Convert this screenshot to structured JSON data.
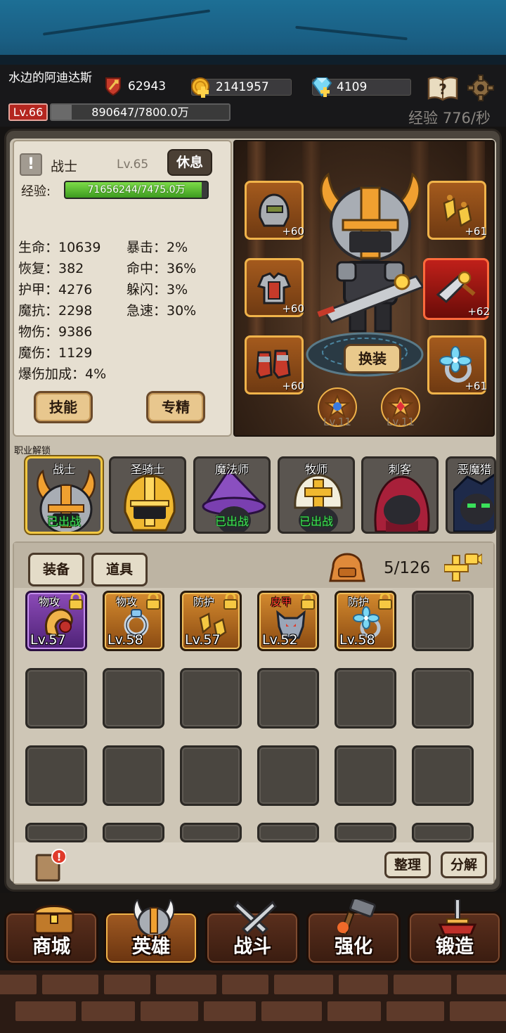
{
  "header": {
    "player_name": "水边的阿迪达斯",
    "power": "62943",
    "gold": "2141957",
    "diamonds": "4109",
    "level": "Lv.66",
    "exp": "890647/7800.0万",
    "exp_progress": 0.115,
    "exp_rate": "经验 776/秒"
  },
  "hero": {
    "class_name": "战士",
    "level": "Lv.65",
    "rest_label": "休息",
    "exp_label": "经验:",
    "exp_value": "71656244/7475.0万",
    "exp_progress": 0.96,
    "stats_left": [
      "生命：10639",
      "恢复：382",
      "护甲：4276",
      "魔抗：2298",
      "物伤：9386",
      "魔伤：1129",
      "爆伤加成：4%"
    ],
    "stats_right": [
      "暴击：2%",
      "命中：36%",
      "躲闪：3%",
      "急速：30%"
    ],
    "skill_label": "技能",
    "specialize_label": "专精",
    "change_label": "换装",
    "equip_plus": [
      "+60",
      "+61",
      "+60",
      "+62",
      "+60",
      "+61"
    ],
    "small_slot_levels": [
      "Lv.11",
      "Lv.11"
    ]
  },
  "class_unlock": {
    "title": "职业解锁",
    "classes": [
      {
        "name": "战士",
        "status": "已出战"
      },
      {
        "name": "圣骑士",
        "status": ""
      },
      {
        "name": "魔法师",
        "status": "已出战"
      },
      {
        "name": "牧师",
        "status": "已出战"
      },
      {
        "name": "刺客",
        "status": ""
      },
      {
        "name": "恶魔猎",
        "status": ""
      }
    ]
  },
  "inventory": {
    "tab_equipment": "装备",
    "tab_items": "道具",
    "capacity": "5/126",
    "items": [
      {
        "type": "物攻",
        "level": "Lv.57"
      },
      {
        "type": "物攻",
        "level": "Lv.58"
      },
      {
        "type": "防护",
        "level": "Lv.57"
      },
      {
        "type": "皮甲",
        "level": "Lv.52"
      },
      {
        "type": "防护",
        "level": "Lv.58"
      }
    ],
    "sort_label": "整理",
    "decompose_label": "分解"
  },
  "nav": {
    "shop": "商城",
    "hero": "英雄",
    "battle": "战斗",
    "enhance": "强化",
    "forge": "锻造"
  },
  "colors": {
    "gold": "#f0b34a",
    "exp_green": "#5cc034",
    "level_red": "#b4261f",
    "deployed_green": "#45e05c"
  }
}
